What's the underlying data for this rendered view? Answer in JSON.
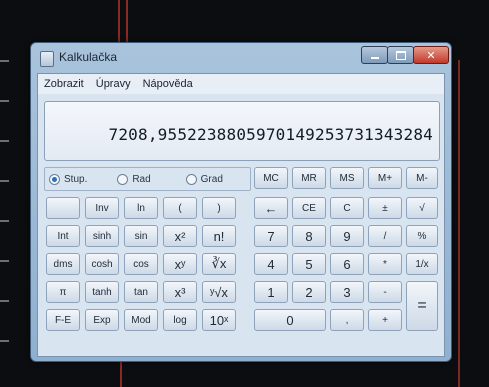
{
  "window": {
    "title": "Kalkulačka"
  },
  "menu": [
    "Zobrazit",
    "Úpravy",
    "Nápověda"
  ],
  "display": {
    "value": "7208,9552238805970149253731343284"
  },
  "angle_units": {
    "options": [
      "Stup.",
      "Rad",
      "Grad"
    ],
    "selected": "Stup."
  },
  "memory_row": [
    "MC",
    "MR",
    "MS",
    "M+",
    "M-"
  ],
  "sci_rows": [
    [
      "",
      "Inv",
      "ln",
      "(",
      ")"
    ],
    [
      "Int",
      "sinh",
      "sin",
      "x²",
      "n!"
    ],
    [
      "dms",
      "cosh",
      "cos",
      "xʸ",
      "∛x"
    ],
    [
      "π",
      "tanh",
      "tan",
      "x³",
      "ʸ√x"
    ],
    [
      "F-E",
      "Exp",
      "Mod",
      "log",
      "10ˣ"
    ]
  ],
  "std_rows": [
    [
      "←",
      "CE",
      "C",
      "±",
      "√"
    ],
    [
      "7",
      "8",
      "9",
      "/",
      "%"
    ],
    [
      "4",
      "5",
      "6",
      "*",
      "1/x"
    ],
    [
      "1",
      "2",
      "3",
      "-"
    ],
    [
      "0",
      ",",
      "+"
    ]
  ],
  "equals": "="
}
